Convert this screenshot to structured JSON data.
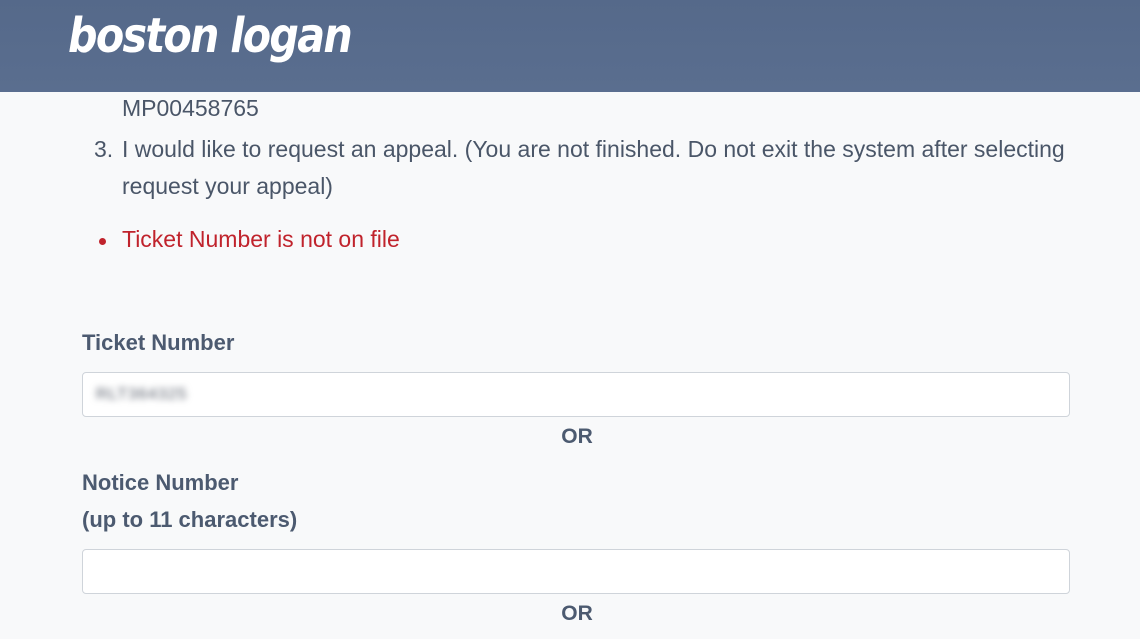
{
  "header": {
    "logo_text": "boston logan"
  },
  "instructions": {
    "ref_number": "MP00458765",
    "option3_number": "3.",
    "option3_line1": "I would like to request an appeal. (You are not finished. Do not exit the system after selecting",
    "option3_line2": "request your appeal)"
  },
  "errors": [
    {
      "text": "Ticket Number is not on file"
    }
  ],
  "form": {
    "ticket_label": "Ticket Number",
    "ticket_value": "RLT364325",
    "or_label_1": "OR",
    "notice_label": "Notice Number",
    "notice_sublabel": "(up to 11 characters)",
    "notice_value": "",
    "or_label_2": "OR"
  },
  "colors": {
    "header_bg": "#5a6e8f",
    "error": "#c0232c",
    "label": "#4c5a70",
    "body_text": "#4a5668"
  }
}
